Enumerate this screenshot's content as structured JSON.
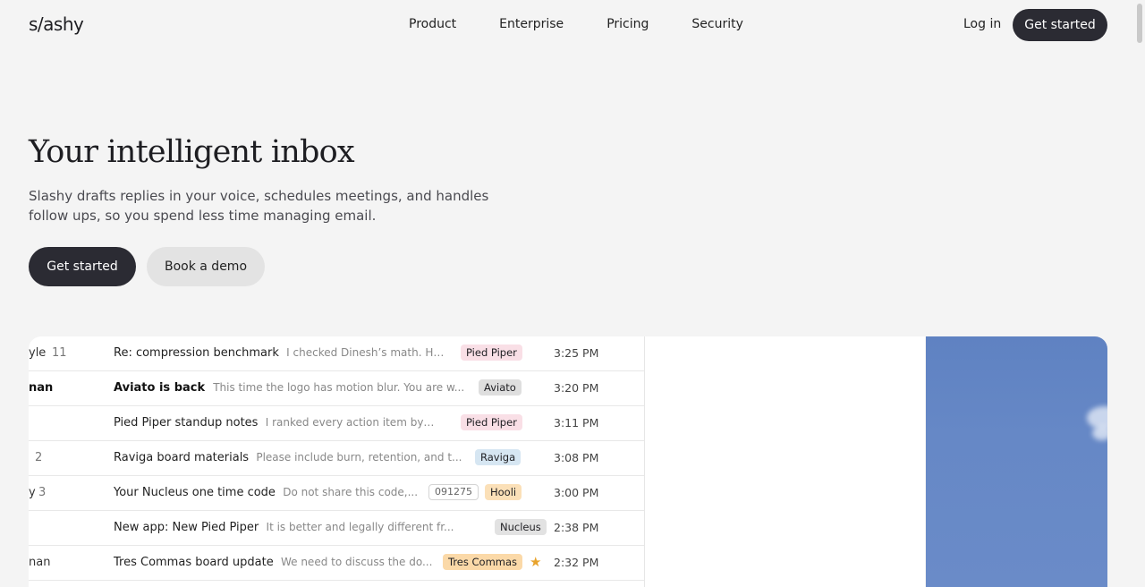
{
  "brand": {
    "logo": "s/ashy"
  },
  "nav": {
    "links": [
      "Product",
      "Enterprise",
      "Pricing",
      "Security"
    ],
    "login": "Log in",
    "cta": "Get started"
  },
  "hero": {
    "title": "Your intelligent inbox",
    "subtitle": "Slashy drafts replies in your voice, schedules meetings, and handles follow ups, so you spend less time managing email.",
    "cta_primary": "Get started",
    "cta_secondary": "Book a demo"
  },
  "inbox": {
    "rows": [
      {
        "sender": "yle",
        "count": "11",
        "subject": "Re: compression benchmark",
        "preview": "I checked Dinesh’s math. Hi...",
        "badge": "Pied Piper",
        "badge_color": "#f9dfe6",
        "code": "",
        "starred": false,
        "time": "3:25 PM",
        "unread": false
      },
      {
        "sender": "nan",
        "count": "",
        "subject": "Aviato is back",
        "preview": "This time the logo has motion blur. You are w...",
        "badge": "Aviato",
        "badge_color": "#dedede",
        "code": "",
        "starred": false,
        "time": "3:20 PM",
        "unread": true
      },
      {
        "sender": "",
        "count": "",
        "subject": "Pied Piper standup notes",
        "preview": "I ranked every action item by fo...",
        "badge": "Pied Piper",
        "badge_color": "#f9dfe6",
        "code": "",
        "starred": false,
        "time": "3:11 PM",
        "unread": false
      },
      {
        "sender": "",
        "count": "2",
        "subject": "Raviga board materials",
        "preview": "Please include burn, retention, and t...",
        "badge": "Raviga",
        "badge_color": "#d6e6f2",
        "code": "",
        "starred": false,
        "time": "3:08 PM",
        "unread": false
      },
      {
        "sender": "y",
        "count": "3",
        "subject": "Your Nucleus one time code",
        "preview": "Do not share this code,...",
        "badge": "Hooli",
        "badge_color": "#fbe0b8",
        "code": "091275",
        "starred": false,
        "time": "3:00 PM",
        "unread": false
      },
      {
        "sender": "",
        "count": "",
        "subject": "New app: New Pied Piper",
        "preview": "It is better and legally different fr...",
        "badge": "Nucleus",
        "badge_color": "#e2e2e2",
        "code": "",
        "starred": false,
        "time": "2:38 PM",
        "unread": false
      },
      {
        "sender": "nan",
        "count": "",
        "subject": "Tres Commas board update",
        "preview": "We need to discuss the do...",
        "badge": "Tres Commas",
        "badge_color": "#fbd9a8",
        "code": "",
        "starred": true,
        "time": "2:32 PM",
        "unread": false
      }
    ]
  },
  "colors": {
    "primary": "#2b2b33",
    "background": "#f4f4f4",
    "secondary_button": "#e3e3e3",
    "star": "#e8a32c",
    "photo_sky": "#6386c4"
  }
}
